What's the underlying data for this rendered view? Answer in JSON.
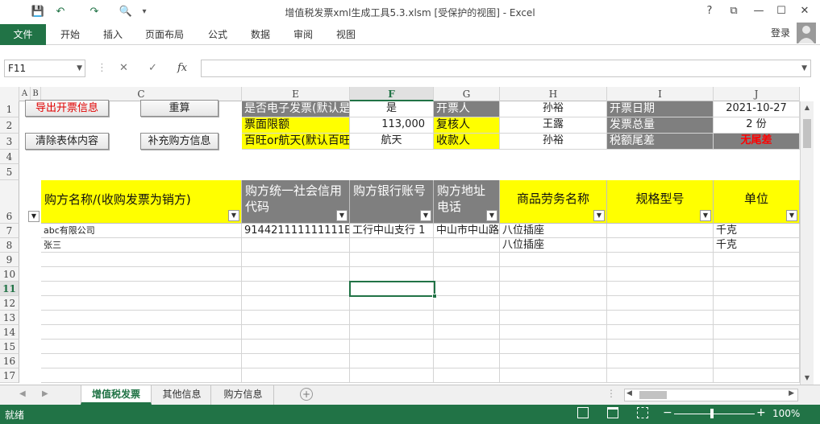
{
  "window": {
    "title": "增值税发票xml生成工具5.3.xlsm  [受保护的视图] - Excel",
    "help": "?",
    "restore": "⧉",
    "minimize": "—",
    "maximize": "☐",
    "close": "✕"
  },
  "quick_access": {
    "save": "💾",
    "undo": "↶",
    "redo": "↷",
    "preview": "🔍",
    "more": "▾"
  },
  "ribbon": {
    "file": "文件",
    "tabs": [
      "开始",
      "插入",
      "页面布局",
      "公式",
      "数据",
      "审阅",
      "视图"
    ],
    "login": "登录"
  },
  "formula_bar": {
    "name_box": "F11",
    "cancel": "✕",
    "enter": "✓",
    "fx": "fx",
    "value": ""
  },
  "columns": [
    "A",
    "B",
    "C",
    "E",
    "F",
    "G",
    "H",
    "I",
    "J"
  ],
  "rows": [
    "1",
    "2",
    "3",
    "4",
    "5",
    "6",
    "7",
    "8",
    "9",
    "10",
    "11",
    "12",
    "13",
    "14",
    "15",
    "16",
    "17"
  ],
  "buttons": {
    "export": "导出开票信息",
    "recalc": "重算",
    "clear": "清除表体内容",
    "supplement": "补充购方信息"
  },
  "info": {
    "e1": "是否电子发票(默认是)",
    "f1": "是",
    "g1": "开票人",
    "h1": "孙裕",
    "i1": "开票日期",
    "j1": "2021-10-27",
    "e2": "票面限额",
    "f2": "113,000",
    "g2": "复核人",
    "h2": "王露",
    "i2": "发票总量",
    "j2": "2 份",
    "e3": "百旺or航天(默认百旺)",
    "f3": "航天",
    "g3": "收款人",
    "h3": "孙裕",
    "i3": "税额尾差",
    "j3": "无尾差"
  },
  "headers": {
    "c": "购方名称/(收购发票为销方)",
    "e": "购方统一社会信用代码",
    "f": "购方银行账号",
    "g": "购方地址电话",
    "h": "商品劳务名称",
    "i": "规格型号",
    "j": "单位"
  },
  "data_rows": [
    {
      "c": "abc有限公司",
      "e": "914421111111111E",
      "f": "工行中山支行 1",
      "g": "中山市中山路",
      "h": "八位插座",
      "i": "",
      "j": "千克"
    },
    {
      "c": "张三",
      "e": "",
      "f": "",
      "g": "",
      "h": "八位插座",
      "i": "",
      "j": "千克"
    }
  ],
  "sheets": [
    "增值税发票",
    "其他信息",
    "购方信息"
  ],
  "status": {
    "ready": "就绪",
    "zoom": "100%"
  },
  "colors": {
    "accent": "#217346",
    "dark_cell": "#7f7f7f",
    "yellow_cell": "#ffff00",
    "red_text": "#ff0000"
  }
}
